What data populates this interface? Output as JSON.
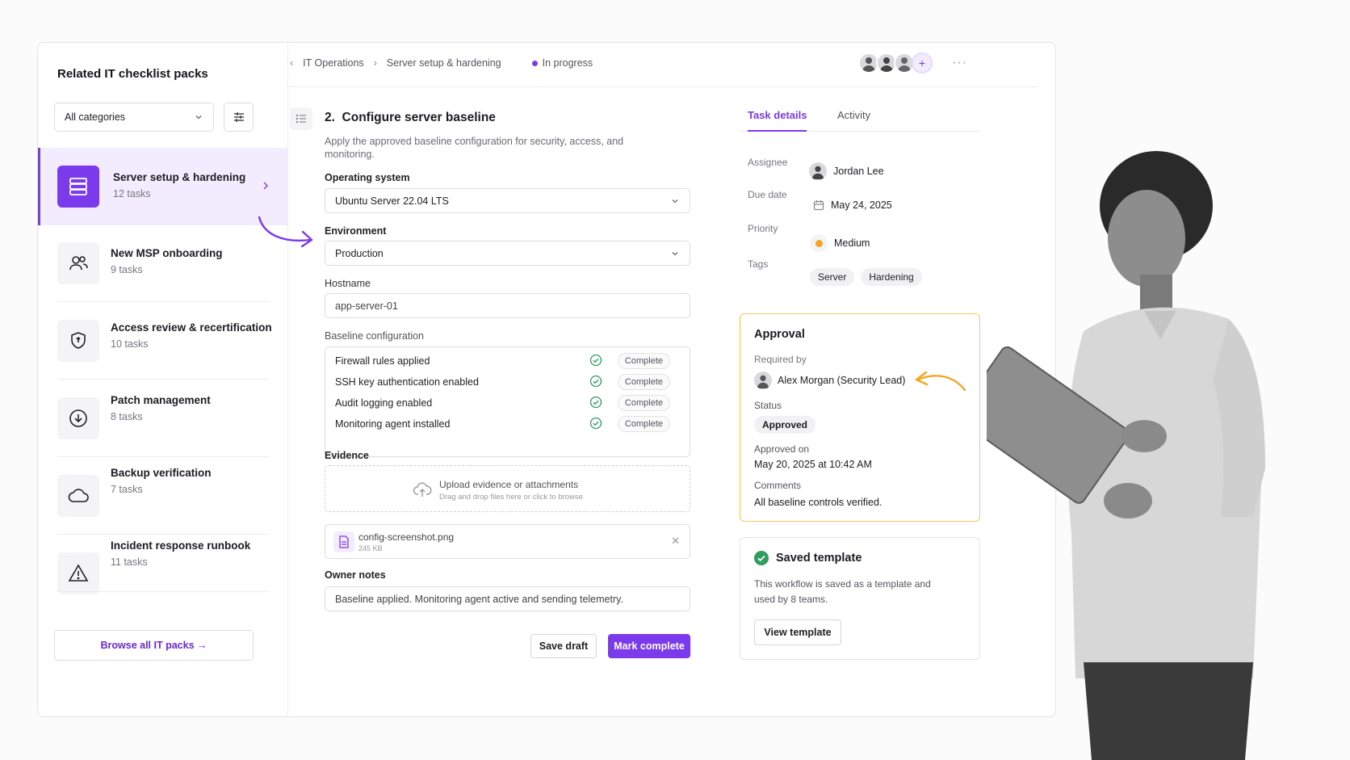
{
  "sidebar": {
    "title": "Related IT checklist packs",
    "category_select": "All categories",
    "packs": [
      {
        "name": "Server setup & hardening",
        "tasks": "12 tasks",
        "icon": "server-icon"
      },
      {
        "name": "New MSP onboarding",
        "tasks": "9 tasks",
        "icon": "users-icon"
      },
      {
        "name": "Access review & recertification",
        "tasks": "10 tasks",
        "icon": "shield-icon"
      },
      {
        "name": "Patch management",
        "tasks": "8 tasks",
        "icon": "download-icon"
      },
      {
        "name": "Backup verification",
        "tasks": "7 tasks",
        "icon": "cloud-icon"
      },
      {
        "name": "Incident response runbook",
        "tasks": "11 tasks",
        "icon": "warning-icon"
      }
    ],
    "browse_label": "Browse all IT packs →"
  },
  "breadcrumb": {
    "root": "IT Operations",
    "current": "Server setup & hardening",
    "status": "In progress"
  },
  "task": {
    "title": "2.  Configure server baseline",
    "description": "Apply the approved baseline configuration for security, access, and monitoring.",
    "os_label": "Operating system",
    "os_value": "Ubuntu Server 22.04 LTS",
    "env_label": "Environment",
    "env_value": "Production",
    "hostname_label": "Hostname",
    "hostname_value": "app-server-01",
    "baseline_label": "Baseline configuration",
    "baseline_items": [
      {
        "label": "Firewall rules applied",
        "status": "Complete"
      },
      {
        "label": "SSH key authentication enabled",
        "status": "Complete"
      },
      {
        "label": "Audit logging enabled",
        "status": "Complete"
      },
      {
        "label": "Monitoring agent installed",
        "status": "Complete"
      }
    ],
    "evidence_label": "Evidence",
    "upload_title": "Upload evidence or attachments",
    "upload_hint": "Drag and drop files here or click to browse",
    "file_name": "config-screenshot.png",
    "file_size": "245 KB",
    "notes_label": "Owner notes",
    "notes_value": "Baseline applied. Monitoring agent active and sending telemetry.",
    "save_draft": "Save draft",
    "mark_complete": "Mark complete"
  },
  "details": {
    "tab_details": "Task details",
    "tab_activity": "Activity",
    "assignee_label": "Assignee",
    "assignee": "Jordan Lee",
    "due_label": "Due date",
    "due": "May 24, 2025",
    "priority_label": "Priority",
    "priority": "Medium",
    "tags_label": "Tags",
    "tags": [
      "Server",
      "Hardening"
    ]
  },
  "approval": {
    "title": "Approval",
    "required_label": "Required by",
    "required_by": "Alex Morgan (Security Lead)",
    "status_label": "Status",
    "status": "Approved",
    "approved_on_label": "Approved on",
    "approved_on": "May 20, 2025 at 10:42 AM",
    "comments_label": "Comments",
    "comments": "All baseline controls verified."
  },
  "saved": {
    "title": "Saved template",
    "text1": "This workflow is saved as a template and",
    "text2": "used by 8 teams.",
    "button": "View template"
  },
  "colors": {
    "accent": "#7c3aed",
    "approval_border": "#f7c76a",
    "priority": "#f5a524",
    "success": "#2f9e5e"
  }
}
